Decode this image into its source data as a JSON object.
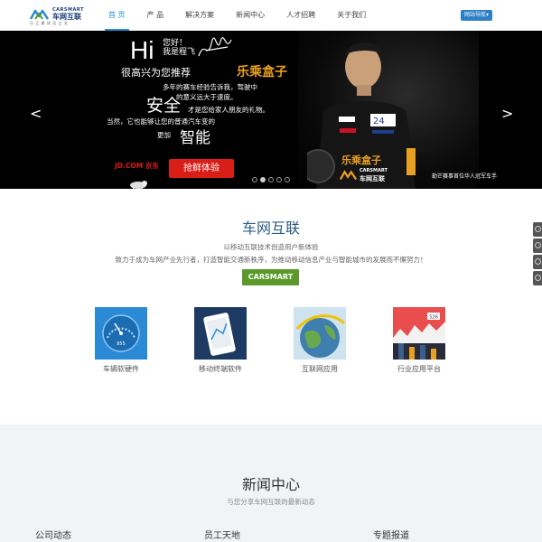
{
  "header": {
    "logo_en": "CARSMART",
    "logo_cn": "车网互联",
    "logo_tag": "乐 之 爵 成 员 企 业",
    "nav": [
      {
        "label": "首 页",
        "active": true
      },
      {
        "label": "产 品",
        "active": false
      },
      {
        "label": "解决方案",
        "active": false
      },
      {
        "label": "新闻中心",
        "active": false
      },
      {
        "label": "人才招聘",
        "active": false
      },
      {
        "label": "关于我们",
        "active": false
      }
    ],
    "site_nav": "网站导航▾"
  },
  "banner": {
    "hi": "Hi",
    "greeting_1": "您好！",
    "greeting_2": "我是程飞",
    "line1_a": "很高兴为您推荐",
    "line1_brand": "乐乘盒子",
    "line2": "多年的赛车经验告诉我，驾驶中",
    "line3": "的意义远大于速度。",
    "line4_big": "安全",
    "line4_small": "才是您给家人朋友的礼物。",
    "line5": "当然，它也能够让您的普通汽车变的",
    "line6_small": "更加",
    "line6_big": "智能",
    "jd": "JD.COM 京东",
    "cta": "抢鲜体验",
    "product_brand": "乐乘盒子",
    "kart_en": "CARSMART",
    "kart_cn": "车网互联",
    "driver_caption": "勒芒赛事首位华人冠军车手",
    "prev": "<",
    "next": ">",
    "slides": 5,
    "active_slide": 1
  },
  "about": {
    "title": "车网互联",
    "sub1": "以移动互联技术创造用户新体验",
    "sub2": "致力于成为车网产业先行者，打造智能交通新秩序，为推动移动信息产业与智能城市的发展而不懈努力！",
    "brand_button": "CARSMART",
    "features": [
      {
        "label": "车辆软硬件",
        "icon": "gauge-icon"
      },
      {
        "label": "移动终端软件",
        "icon": "phone-map-icon"
      },
      {
        "label": "互联网应用",
        "icon": "globe-icon"
      },
      {
        "label": "行业应用平台",
        "icon": "city-chart-icon"
      }
    ],
    "gauge_text": "855",
    "city_badge": "526"
  },
  "news": {
    "title": "新闻中心",
    "sub": "与您分享车网互联的最新动态",
    "columns": [
      "公司动态",
      "员工天地",
      "专题报道"
    ]
  },
  "colors": {
    "accent": "#2a8fd4",
    "cta_red": "#d91e18",
    "brand_orange": "#e8a020",
    "green_button": "#5b9a2a",
    "title_blue": "#2a5b84"
  }
}
